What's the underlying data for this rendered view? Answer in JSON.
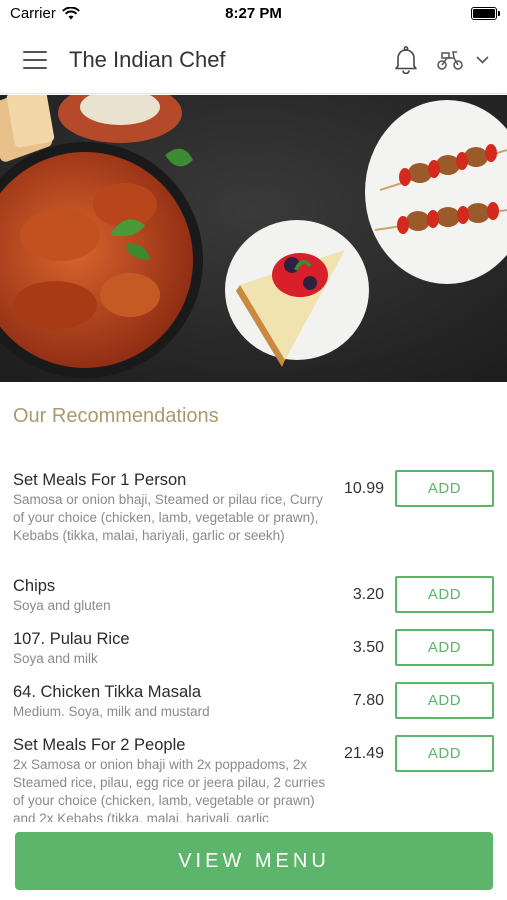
{
  "status_bar": {
    "carrier": "Carrier",
    "time": "8:27 PM",
    "battery_level": 1.0
  },
  "header": {
    "title": "The Indian Chef",
    "icons": [
      "menu-icon",
      "bell-icon",
      "delivery-scooter-icon",
      "chevron-down-icon"
    ]
  },
  "recommendations": {
    "title": "Our Recommendations",
    "items": [
      {
        "name": "Set Meals For 1 Person",
        "description": "Samosa or onion bhaji, Steamed or pilau rice, Curry of your choice (chicken, lamb, vegetable or prawn), Kebabs (tikka, malai, hariyali, garlic or seekh)",
        "price": "10.99",
        "button": "ADD"
      },
      {
        "name": "Chips",
        "description": "Soya and gluten",
        "price": "3.20",
        "button": "ADD"
      },
      {
        "name": "107. Pulau Rice",
        "description": "Soya and milk",
        "price": "3.50",
        "button": "ADD"
      },
      {
        "name": "64. Chicken Tikka Masala",
        "description": "Medium. Soya, milk and mustard",
        "price": "7.80",
        "button": "ADD"
      },
      {
        "name": "Set Meals For 2 People",
        "description": "2x Samosa or onion bhaji with 2x poppadoms, 2x Steamed rice, pilau, egg rice or jeera pilau, 2 curries of your choice (chicken, lamb, vegetable or prawn) and 2x Kebabs (tikka, malai, hariyali, garlic",
        "price": "21.49",
        "button": "ADD"
      }
    ]
  },
  "footer": {
    "view_menu": "VIEW MENU"
  },
  "colors": {
    "accent_green": "#5cb56a",
    "section_title": "#a89a6e"
  }
}
